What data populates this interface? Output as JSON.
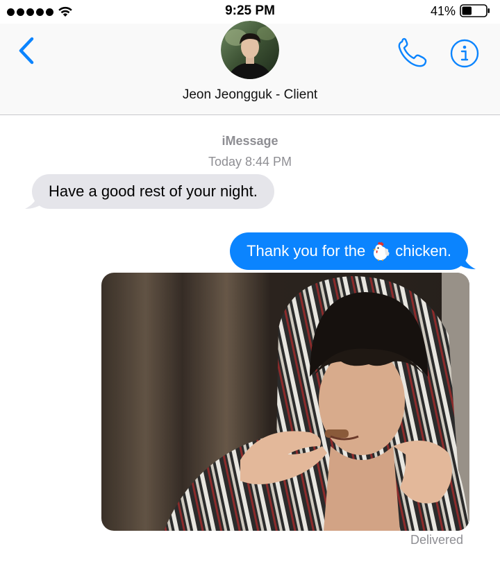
{
  "status_bar": {
    "time": "9:25 PM",
    "battery_percent": "41%",
    "battery_level": 0.41
  },
  "header": {
    "contact_name": "Jeon Jeongguk - Client",
    "back_icon": "chevron-left-icon",
    "call_icon": "phone-icon",
    "info_icon": "info-icon"
  },
  "conversation": {
    "service": "iMessage",
    "timestamp": "Today 8:44 PM",
    "incoming": {
      "text": "Have a good rest of your night."
    },
    "outgoing": {
      "text_before": "Thank you for the",
      "emoji": "rooster-emoji",
      "text_after": "chicken."
    },
    "photo_attachment": {
      "description_icon": "photo-attachment"
    },
    "delivery_status": "Delivered"
  },
  "colors": {
    "accent": "#0b84fe",
    "incoming_bubble": "#e5e5ea",
    "meta_text": "#8e8e93"
  }
}
